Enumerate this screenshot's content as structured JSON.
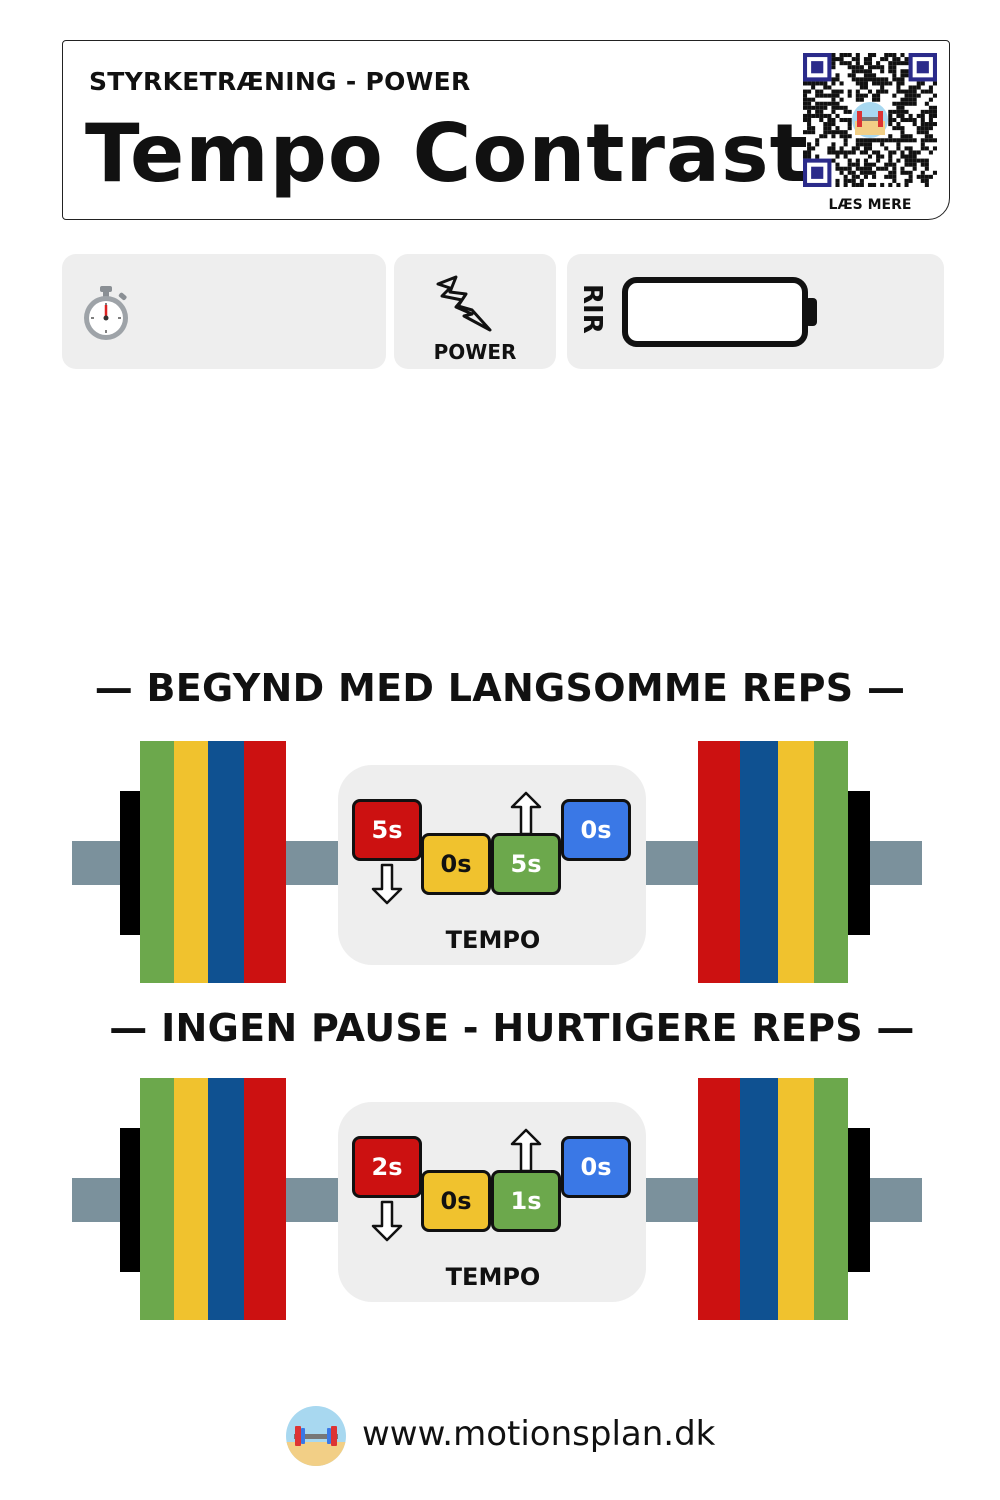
{
  "header": {
    "subtitle": "STYRKETRÆNING - POWER",
    "title": "Tempo Contrast",
    "qr_label": "LÆS MERE"
  },
  "stats": {
    "timer_icon": "stopwatch-icon",
    "power_icon": "lightning-icon",
    "power_label": "POWER",
    "rir_label": "RIR",
    "rir_icon": "battery-empty-icon"
  },
  "colors": {
    "red": "#cc1111",
    "yellow": "#f0c22e",
    "green": "#6ca84c",
    "blue": "#3a78e6",
    "plate_blue": "#0f5191",
    "bar_gray": "#7b919c",
    "tile_bg": "#eeeeee"
  },
  "sections": [
    {
      "heading": "— BEGYND MED LANGSOMME REPS —",
      "tempo": {
        "eccentric": "5s",
        "pause_bottom": "0s",
        "concentric": "5s",
        "pause_top": "0s",
        "label": "TEMPO"
      }
    },
    {
      "heading": "— INGEN PAUSE - HURTIGERE REPS —",
      "tempo": {
        "eccentric": "2s",
        "pause_bottom": "0s",
        "concentric": "1s",
        "pause_top": "0s",
        "label": "TEMPO"
      }
    }
  ],
  "footer": {
    "url": "www.motionsplan.dk",
    "logo_icon": "motionsplan-logo-icon"
  }
}
